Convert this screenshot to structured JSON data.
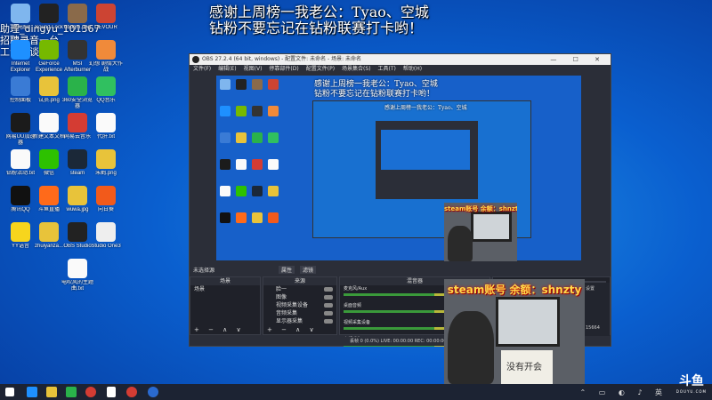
{
  "overlay": {
    "line1": "感谢上周榜一我老公：Tyao、空城",
    "line2": "钻粉不要忘记在钻粉联赛打卡哟！"
  },
  "top_left_lines": [
    "助理_dingyu_101367",
    "招聘录音一台",
    "工会可谈"
  ],
  "desktop_icons": [
    {
      "name": "此电脑",
      "icon": "computer-icon",
      "color": "#7fb6ee"
    },
    {
      "name": "Sound Lock",
      "icon": "sound-lock-icon",
      "color": "#222"
    },
    {
      "name": "dbpgm.png",
      "icon": "image-file-icon",
      "color": "#8a6a4a"
    },
    {
      "name": "DEVOUR",
      "icon": "devour-icon",
      "color": "#c43"
    },
    {
      "name": "Internet Explorer",
      "icon": "ie-icon",
      "color": "#1e90ff"
    },
    {
      "name": "GeForce Experience",
      "icon": "geforce-icon",
      "color": "#76b900"
    },
    {
      "name": "MSI Afterburner",
      "icon": "msi-icon",
      "color": "#333"
    },
    {
      "name": "幻想 剧情大作战",
      "icon": "game-icon",
      "color": "#f08a3a"
    },
    {
      "name": "控制面板",
      "icon": "control-panel-icon",
      "color": "#3a7bd5"
    },
    {
      "name": "试员.png",
      "icon": "chrome-icon",
      "color": "#e8c33a"
    },
    {
      "name": "360安全浏览器",
      "icon": "browser-icon",
      "color": "#2ab24a"
    },
    {
      "name": "QQ音乐",
      "icon": "qq-music-icon",
      "color": "#30c060"
    },
    {
      "name": "网易UU加速器",
      "icon": "uu-icon",
      "color": "#1b1b1b"
    },
    {
      "name": "新建文本文档",
      "icon": "text-file-icon",
      "color": "#fafafa"
    },
    {
      "name": "网易云音乐",
      "icon": "netease-music-icon",
      "color": "#d43c33"
    },
    {
      "name": "代肝.txt",
      "icon": "text-file-icon",
      "color": "#fafafa"
    },
    {
      "name": "钻粉活动.txt",
      "icon": "text-file-icon",
      "color": "#fafafa"
    },
    {
      "name": "微信",
      "icon": "wechat-icon",
      "color": "#2dc100"
    },
    {
      "name": "steam",
      "icon": "steam-icon",
      "color": "#1b2838"
    },
    {
      "name": "朱鹤.png",
      "icon": "chrome-icon",
      "color": "#e8c33a"
    },
    {
      "name": "腾讯QQ",
      "icon": "qq-icon",
      "color": "#111"
    },
    {
      "name": "斗鱼直播",
      "icon": "douyu-icon",
      "color": "#ff6a1a"
    },
    {
      "name": "wuwa.jpg",
      "icon": "chrome-icon",
      "color": "#e8c33a"
    },
    {
      "name": "向日葵",
      "icon": "sunflower-icon",
      "color": "#f25a1b"
    },
    {
      "name": "YY语音",
      "icon": "yy-icon",
      "color": "#f7d51d"
    },
    {
      "name": "zhuiyanza...",
      "icon": "chrome-icon",
      "color": "#e8c33a"
    },
    {
      "name": "OBS Studio",
      "icon": "obs-icon",
      "color": "#222"
    },
    {
      "name": "Studio One3",
      "icon": "studio-one-icon",
      "color": "#eee"
    },
    {
      "name": "电吹风的主题曲.txt",
      "icon": "text-file-icon",
      "color": "#fafafa"
    }
  ],
  "obs": {
    "title": "OBS 27.2.4 (64 bit, windows) - 配置文件: 未命名 - 场景: 未命名",
    "menu": [
      "文件(F)",
      "编辑(E)",
      "视图(V)",
      "停靠部件(D)",
      "配置文件(P)",
      "场景集合(S)",
      "工具(T)",
      "帮助(H)"
    ],
    "window_controls": "— ☐ ✕",
    "no_source": "未选择源",
    "props_label": "属性",
    "filters_label": "滤镜",
    "panels": {
      "scenes": {
        "header": "场景",
        "items": [
          "场景"
        ]
      },
      "sources": {
        "header": "来源",
        "items": [
          "脸一",
          "图像",
          "视频采集设备",
          "音频采集",
          "显示器采集"
        ]
      },
      "mixer": {
        "header": "混音器",
        "channels": [
          "麦克风/Aux",
          "桌面音频",
          "视频采集设备",
          "音频采集"
        ]
      }
    },
    "controls_side": [
      "设置",
      "工作室模式",
      "录制",
      "推流",
      "虚拟摄像机"
    ],
    "footer_buttons": "+ − ∧ ∨",
    "status": "丢帧 0 (0.0%)    LIVE: 00:00:00    REC: 00:00:00    CPU: 12%    00:00",
    "right_number": "15664",
    "right_label": "设置"
  },
  "webcam": {
    "banner": "steam账号 余额：shnzty",
    "paper_text": "没有开会"
  },
  "watermark": {
    "logo": "斗鱼",
    "sub": "DOUYU.COM"
  }
}
